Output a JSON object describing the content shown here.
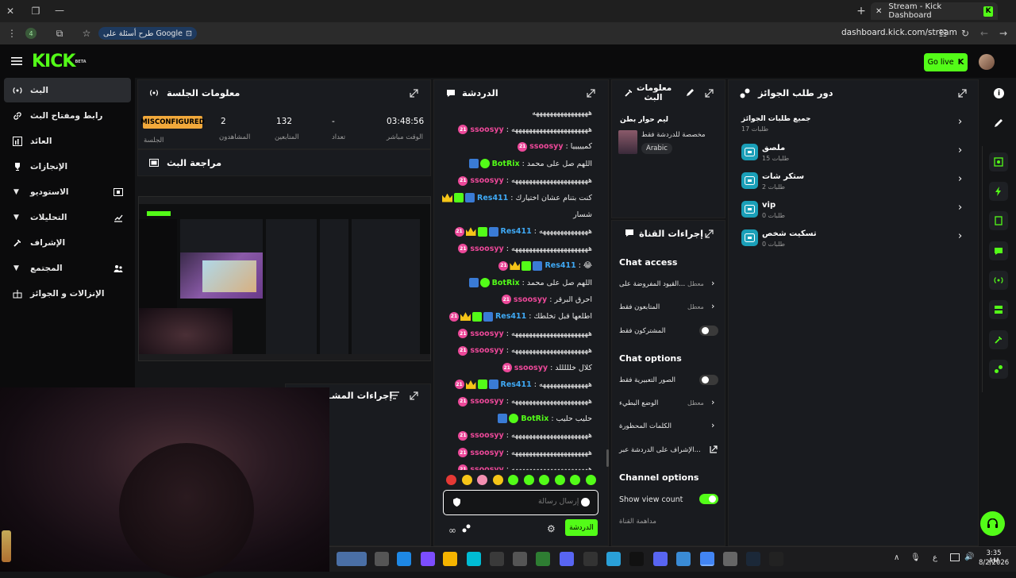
{
  "browser": {
    "tab_title": "Stream - Kick Dashboard",
    "ask_google": "طرح أسئلة على Google",
    "url": "dashboard.kick.com/stream",
    "ext_count": "4"
  },
  "header": {
    "logo": "KICK",
    "logo_tag": "BETA",
    "go_live": "Go live"
  },
  "sidebar": {
    "items": [
      {
        "label": "البث"
      },
      {
        "label": "رابط ومفتاح البث"
      },
      {
        "label": "العائد"
      },
      {
        "label": "الإنجازات"
      },
      {
        "label": "الاستوديو"
      },
      {
        "label": "التحليلات"
      },
      {
        "label": "الإشراف"
      },
      {
        "label": "المجتمع"
      },
      {
        "label": "الإنزالات و الجوائز"
      }
    ]
  },
  "session": {
    "title": "معلومات الجلسة",
    "stats": [
      {
        "value": "03:48:56",
        "label": "الوقت مباشر"
      },
      {
        "value": "-",
        "label": "تعداد"
      },
      {
        "value": "132",
        "label": "المتابعين"
      },
      {
        "value": "2",
        "label": "المشاهدون"
      },
      {
        "value": "MISCONFIGURED",
        "label": "الجلسة"
      }
    ]
  },
  "review": {
    "title": "مراجعة البث"
  },
  "actions_left": {
    "title": "إجراءات المشـ"
  },
  "chat": {
    "title": "الدردشة",
    "colors": {
      "ssoos": "#ec4899",
      "botrix": "#53fc18",
      "res": "#3fa9f5"
    },
    "lines": [
      {
        "user": "",
        "text": "ههههههههههههههههه",
        "kind": "cont"
      },
      {
        "user": "ssoosyy",
        "text": "ههههههههههههههههههههههه",
        "kind": "ssoos"
      },
      {
        "user": "ssoosyy",
        "text": "كميييييا",
        "kind": "ssoos"
      },
      {
        "user": "BotRix",
        "text": "اللهم صل على محمد",
        "kind": "botrix"
      },
      {
        "user": "ssoosyy",
        "text": "ههههههههههههههههههههههه",
        "kind": "ssoos"
      },
      {
        "user": "Res411",
        "text": "كنت بتنام عشان اختيارك",
        "kind": "res"
      },
      {
        "user": "",
        "text": "شسار",
        "kind": "cont"
      },
      {
        "user": "Res411",
        "text": "ههههههههههههههه",
        "kind": "res"
      },
      {
        "user": "ssoosyy",
        "text": "ههههههههههههههههههههههه",
        "kind": "ssoos"
      },
      {
        "user": "Res411",
        "text": "😂",
        "kind": "res"
      },
      {
        "user": "BotRix",
        "text": "اللهم صل على محمد",
        "kind": "botrix"
      },
      {
        "user": "ssoosyy",
        "text": "احرق البرقر",
        "kind": "ssoos"
      },
      {
        "user": "Res411",
        "text": "اطلعها قبل تخلطك",
        "kind": "res"
      },
      {
        "user": "ssoosyy",
        "text": "ههههههههههههههههههههههه",
        "kind": "ssoos"
      },
      {
        "user": "ssoosyy",
        "text": "ههههههههههههههههههههههه",
        "kind": "ssoos"
      },
      {
        "user": "ssoosyy",
        "text": "كلال خلللللد",
        "kind": "ssoos"
      },
      {
        "user": "Res411",
        "text": "ههههههههههههههه",
        "kind": "res"
      },
      {
        "user": "ssoosyy",
        "text": "ههههههههههههههههههههههه",
        "kind": "ssoos"
      },
      {
        "user": "BotRix",
        "text": "حليب حليب",
        "kind": "botrix"
      },
      {
        "user": "ssoosyy",
        "text": "ههههههههههههههههههههههه",
        "kind": "ssoos"
      },
      {
        "user": "ssoosyy",
        "text": "ههههههههههههههههههههههه",
        "kind": "ssoos"
      },
      {
        "user": "ssoosyy",
        "text": "ههههههههههههههههههههههه",
        "kind": "ssoos"
      }
    ],
    "input_placeholder": "إرسال رسالة",
    "send_label": "الدردشة"
  },
  "stream_info": {
    "title": "معلومات البث",
    "stream_title": "ليم حوار بطن",
    "category": "مخصصة للدردشة فقط",
    "language": "Arabic"
  },
  "channel_actions": {
    "title": "إجراءات القناة",
    "chat_access": "Chat access",
    "chat_options": "Chat options",
    "channel_options": "Channel options",
    "settings": [
      {
        "label": "القيود المفروضة على...",
        "value": "معطل"
      },
      {
        "label": "المتابعون فقط",
        "value": "معطل"
      },
      {
        "label": "المشتركون فقط",
        "value": ""
      },
      {
        "label": "الصور التعبيرية فقط",
        "value": ""
      },
      {
        "label": "الوضع البطيء",
        "value": "معطل"
      },
      {
        "label": "الكلمات المحظورة",
        "value": ""
      },
      {
        "label": "الإشراف على الدردشة عبر...",
        "value": ""
      },
      {
        "label": "Show view count",
        "value": ""
      },
      {
        "label": "مداهمة القناة",
        "value": ""
      }
    ]
  },
  "rewards": {
    "title": "دور طلب الجوائز",
    "items": [
      {
        "title": "جميع طلبات الجوائز",
        "sub": "طلبات 17"
      },
      {
        "title": "ملصق",
        "sub": "طلبات 15"
      },
      {
        "title": "ستكر شات",
        "sub": "طلبات 2"
      },
      {
        "title": "vip",
        "sub": "طلبات 0"
      },
      {
        "title": "تسكيت شخص",
        "sub": "طلبات 0"
      }
    ]
  },
  "taskbar": {
    "time": "3:35 AM",
    "date": "8/2/2026",
    "lang": "ع"
  }
}
